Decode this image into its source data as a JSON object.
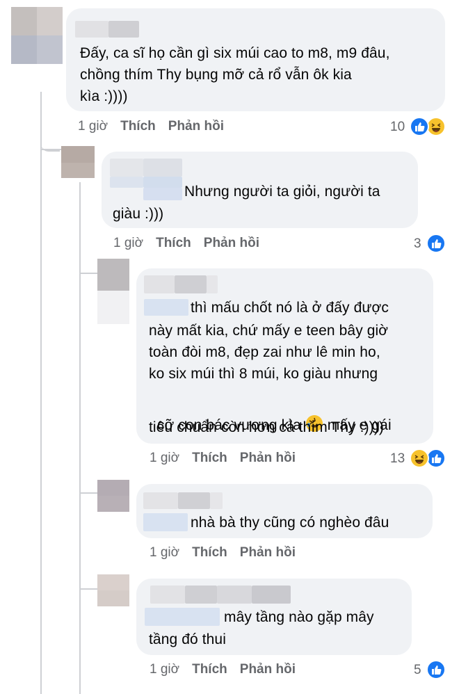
{
  "comments": [
    {
      "text": "Đấy, ca sĩ họ cần gì six múi cao to m8, m9 đâu,\nchồng thím Thy bụng mỡ cả rổ vẫn ôk kia\nkìa :))))",
      "time": "1 giờ",
      "like_label": "Thích",
      "reply_label": "Phản hồi",
      "reaction_count": "10",
      "reactions": [
        "like-icon",
        "haha-icon"
      ]
    },
    {
      "text_line1": "Nhưng người ta giỏi, người ta",
      "text_line2": "giàu :)))",
      "time": "1 giờ",
      "like_label": "Thích",
      "reply_label": "Phản hồi",
      "reaction_count": "3",
      "reactions": [
        "like-icon"
      ]
    },
    {
      "text_line1": "thì mấu chốt nó là ở đấy được",
      "text_rest": "này mất kia, chứ mấy e teen bây giờ\ntoàn đòi m8, đẹp zai như lê min ho,\nko six múi thì 8 múi, ko giàu nhưng",
      "text_line5a": "cỡ con bác vượng kìa ",
      "text_line5b": " mấy e gái",
      "text_line6": "tiêu chuẩn còn hơn cả thím Thy :))))",
      "inline_emoji": "rofl-emoji",
      "time": "1 giờ",
      "like_label": "Thích",
      "reply_label": "Phản hồi",
      "reaction_count": "13",
      "reactions": [
        "haha-icon",
        "like-icon"
      ]
    },
    {
      "text": "nhà bà thy cũng có nghèo đâu",
      "time": "1 giờ",
      "like_label": "Thích",
      "reply_label": "Phản hồi"
    },
    {
      "text_line1": "mây tầng nào gặp mây",
      "text_line2": "tầng đó thui",
      "time": "1 giờ",
      "like_label": "Thích",
      "reply_label": "Phản hồi",
      "reaction_count": "5",
      "reactions": [
        "like-icon"
      ]
    }
  ],
  "colors": {
    "bubble": "#f0f2f5",
    "meta_text": "#65676b",
    "like_blue": "#1877f2",
    "haha_yellow": "#f7c22c",
    "thread_line": "#ced0d4"
  }
}
